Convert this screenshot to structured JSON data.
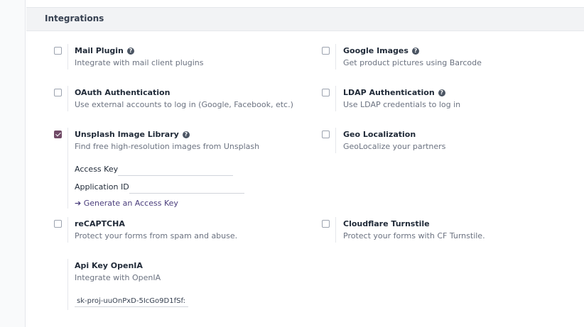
{
  "section": {
    "title": "Integrations"
  },
  "settings": {
    "mail_plugin": {
      "title": "Mail Plugin",
      "desc": "Integrate with mail client plugins",
      "checked": false
    },
    "google_images": {
      "title": "Google Images",
      "desc": "Get product pictures using Barcode",
      "checked": false
    },
    "oauth": {
      "title": "OAuth Authentication",
      "desc": "Use external accounts to log in (Google, Facebook, etc.)",
      "checked": false
    },
    "ldap": {
      "title": "LDAP Authentication",
      "desc": "Use LDAP credentials to log in",
      "checked": false
    },
    "unsplash": {
      "title": "Unsplash Image Library",
      "desc": "Find free high-resolution images from Unsplash",
      "checked": true,
      "access_key_label": "Access Key",
      "access_key_value": "",
      "app_id_label": "Application ID",
      "app_id_value": "",
      "generate_link": "➔ Generate an Access Key"
    },
    "geo": {
      "title": "Geo Localization",
      "desc": "GeoLocalize your partners",
      "checked": false
    },
    "recaptcha": {
      "title": "reCAPTCHA",
      "desc": "Protect your forms from spam and abuse.",
      "checked": false
    },
    "cloudflare": {
      "title": "Cloudflare Turnstile",
      "desc": "Protect your forms with CF Turnstile.",
      "checked": false
    },
    "openia": {
      "title": "Api Key OpenIA",
      "desc": "Integrate with OpenIA",
      "api_key_value": "sk-proj-uuOnPxD-5IcGo9D1fSf:"
    }
  },
  "colors": {
    "accent": "#714b67",
    "link": "#4a3d7c",
    "header_bg": "#f2f3f5"
  }
}
